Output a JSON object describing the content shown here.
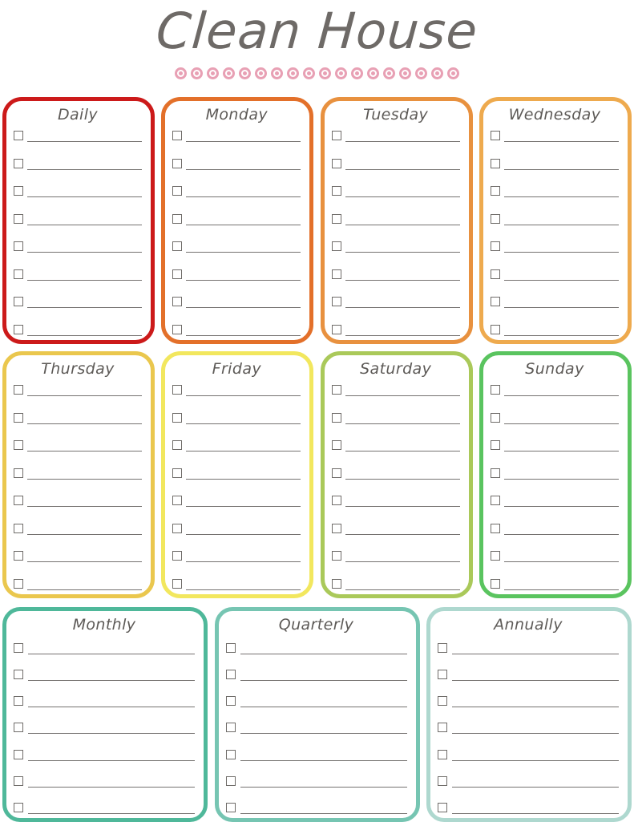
{
  "header": {
    "title": "Clean House",
    "divider_dot_count": 18,
    "dot_color": "#e8a0b4",
    "title_color": "#6e6a67"
  },
  "board": {
    "checkbox_border_color": "#6f6c69",
    "task_line_color": "#757270",
    "rows": [
      {
        "name": "weekday-row-1",
        "cards": [
          {
            "title": "Daily",
            "color": "#cc1a1a",
            "task_count": 8
          },
          {
            "title": "Monday",
            "color": "#e3702a",
            "task_count": 8
          },
          {
            "title": "Tuesday",
            "color": "#e8913f",
            "task_count": 8
          },
          {
            "title": "Wednesday",
            "color": "#eeaa4e",
            "task_count": 8
          }
        ]
      },
      {
        "name": "weekday-row-2",
        "cards": [
          {
            "title": "Thursday",
            "color": "#eac74e",
            "task_count": 8
          },
          {
            "title": "Friday",
            "color": "#f2e75e",
            "task_count": 8
          },
          {
            "title": "Saturday",
            "color": "#aac95a",
            "task_count": 8
          },
          {
            "title": "Sunday",
            "color": "#5ac45f",
            "task_count": 8
          }
        ]
      },
      {
        "name": "period-row",
        "cards": [
          {
            "title": "Monthly",
            "color": "#4fb89a",
            "task_count": 7
          },
          {
            "title": "Quarterly",
            "color": "#76c5b2",
            "task_count": 7
          },
          {
            "title": "Annually",
            "color": "#aed8cf",
            "task_count": 7
          }
        ]
      }
    ]
  }
}
